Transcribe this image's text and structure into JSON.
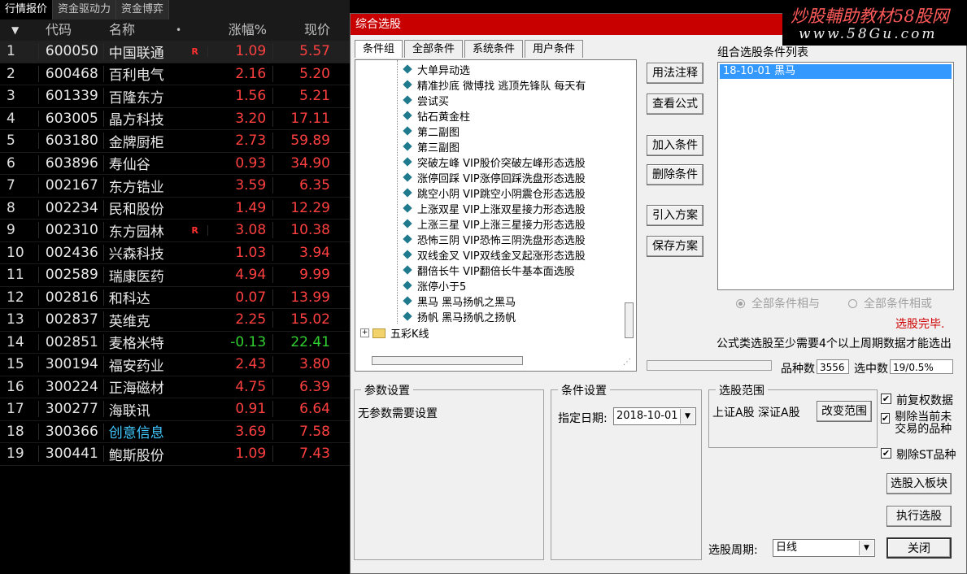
{
  "top_tabs": [
    "行情报价",
    "资金驱动力",
    "资金博弈"
  ],
  "table": {
    "headers": {
      "idx_arrow": "▼",
      "code": "代码",
      "name": "名称",
      "name_dot": "•",
      "change": "涨幅%",
      "price": "现价"
    },
    "rows": [
      {
        "idx": "1",
        "code": "600050",
        "name": "中国联通",
        "flag": "R",
        "change": "1.09",
        "price": "5.57",
        "dir": "up"
      },
      {
        "idx": "2",
        "code": "600468",
        "name": "百利电气",
        "flag": "",
        "change": "2.16",
        "price": "5.20",
        "dir": "up"
      },
      {
        "idx": "3",
        "code": "601339",
        "name": "百隆东方",
        "flag": "",
        "change": "1.56",
        "price": "5.21",
        "dir": "up"
      },
      {
        "idx": "4",
        "code": "603005",
        "name": "晶方科技",
        "flag": "",
        "change": "3.20",
        "price": "17.11",
        "dir": "up"
      },
      {
        "idx": "5",
        "code": "603180",
        "name": "金牌厨柜",
        "flag": "",
        "change": "2.73",
        "price": "59.89",
        "dir": "up"
      },
      {
        "idx": "6",
        "code": "603896",
        "name": "寿仙谷",
        "flag": "",
        "change": "0.93",
        "price": "34.90",
        "dir": "up"
      },
      {
        "idx": "7",
        "code": "002167",
        "name": "东方锆业",
        "flag": "",
        "change": "3.59",
        "price": "6.35",
        "dir": "up"
      },
      {
        "idx": "8",
        "code": "002234",
        "name": "民和股份",
        "flag": "",
        "change": "1.49",
        "price": "12.29",
        "dir": "up"
      },
      {
        "idx": "9",
        "code": "002310",
        "name": "东方园林",
        "flag": "R",
        "change": "3.08",
        "price": "10.38",
        "dir": "up"
      },
      {
        "idx": "10",
        "code": "002436",
        "name": "兴森科技",
        "flag": "",
        "change": "1.03",
        "price": "3.94",
        "dir": "up"
      },
      {
        "idx": "11",
        "code": "002589",
        "name": "瑞康医药",
        "flag": "",
        "change": "4.94",
        "price": "9.99",
        "dir": "up"
      },
      {
        "idx": "12",
        "code": "002816",
        "name": "和科达",
        "flag": "",
        "change": "0.07",
        "price": "13.99",
        "dir": "up"
      },
      {
        "idx": "13",
        "code": "002837",
        "name": "英维克",
        "flag": "",
        "change": "2.25",
        "price": "15.02",
        "dir": "up"
      },
      {
        "idx": "14",
        "code": "002851",
        "name": "麦格米特",
        "flag": "",
        "change": "-0.13",
        "price": "22.41",
        "dir": "down"
      },
      {
        "idx": "15",
        "code": "300194",
        "name": "福安药业",
        "flag": "",
        "change": "2.43",
        "price": "3.80",
        "dir": "up"
      },
      {
        "idx": "16",
        "code": "300224",
        "name": "正海磁材",
        "flag": "",
        "change": "4.75",
        "price": "6.39",
        "dir": "up"
      },
      {
        "idx": "17",
        "code": "300277",
        "name": "海联讯",
        "flag": "",
        "change": "0.91",
        "price": "6.64",
        "dir": "up"
      },
      {
        "idx": "18",
        "code": "300366",
        "name": "创意信息",
        "flag": "",
        "change": "3.69",
        "price": "7.58",
        "dir": "up",
        "name_color": "blue"
      },
      {
        "idx": "19",
        "code": "300441",
        "name": "鲍斯股份",
        "flag": "",
        "change": "1.09",
        "price": "7.43",
        "dir": "up"
      }
    ]
  },
  "dialog": {
    "title": "综合选股",
    "watermark": {
      "line1": "炒股輔助教材58股网",
      "line2": "www.58Gu.com"
    },
    "tabs": [
      "条件组",
      "全部条件",
      "系统条件",
      "用户条件"
    ],
    "tree_items": [
      "大单异动选",
      "精准抄底 微博找 逃顶先锋队 每天有",
      "尝试买",
      "钻石黄金柱",
      "第二副图",
      "第三副图",
      "突破左峰 VIP股价突破左峰形态选股",
      "涨停回踩 VIP涨停回踩洗盘形态选股",
      "跳空小阴 VIP跳空小阴震仓形态选股",
      "上涨双星 VIP上涨双星接力形态选股",
      "上涨三星 VIP上涨三星接力形态选股",
      "恐怖三阴 VIP恐怖三阴洗盘形态选股",
      "双线金叉 VIP双线金叉起涨形态选股",
      "翻倍长牛 VIP翻倍长牛基本面选股",
      "涨停小于5",
      "黑马 黑马扬帆之黑马",
      "扬帆 黑马扬帆之扬帆"
    ],
    "tree_folder": "五彩K线",
    "tree_folder_toggle": "+",
    "grip": "⋰",
    "buttons": {
      "usage": "用法注释",
      "view_formula": "查看公式",
      "add_cond": "加入条件",
      "del_cond": "删除条件",
      "import_plan": "引入方案",
      "save_plan": "保存方案",
      "change_range": "改变范围",
      "to_block": "选股入板块",
      "execute": "执行选股",
      "close": "关闭"
    },
    "combo_label": "组合选股条件列表",
    "combo_items": [
      "18-10-01 黑马"
    ],
    "radio_and": "全部条件相与",
    "radio_or": "全部条件相或",
    "status": "选股完毕.",
    "note": "公式类选股至少需要4个以上周期数据才能选出",
    "count_label": "品种数",
    "count_value": "3556",
    "selected_label": "选中数",
    "selected_value": "19/0.5%",
    "param_group": "参数设置",
    "param_text": "无参数需要设置",
    "cond_group": "条件设置",
    "date_label": "指定日期:",
    "date_value": "2018-10-01",
    "range_group": "选股范围",
    "range_text": "上证A股 深证A股",
    "checks": {
      "fuquan": "前复权数据",
      "exclude_untraded": "剔除当前未交易的品种",
      "exclude_st": "剔除ST品种"
    },
    "period_label": "选股周期:",
    "period_value": "日线",
    "dropdown_arrow": "▼"
  }
}
